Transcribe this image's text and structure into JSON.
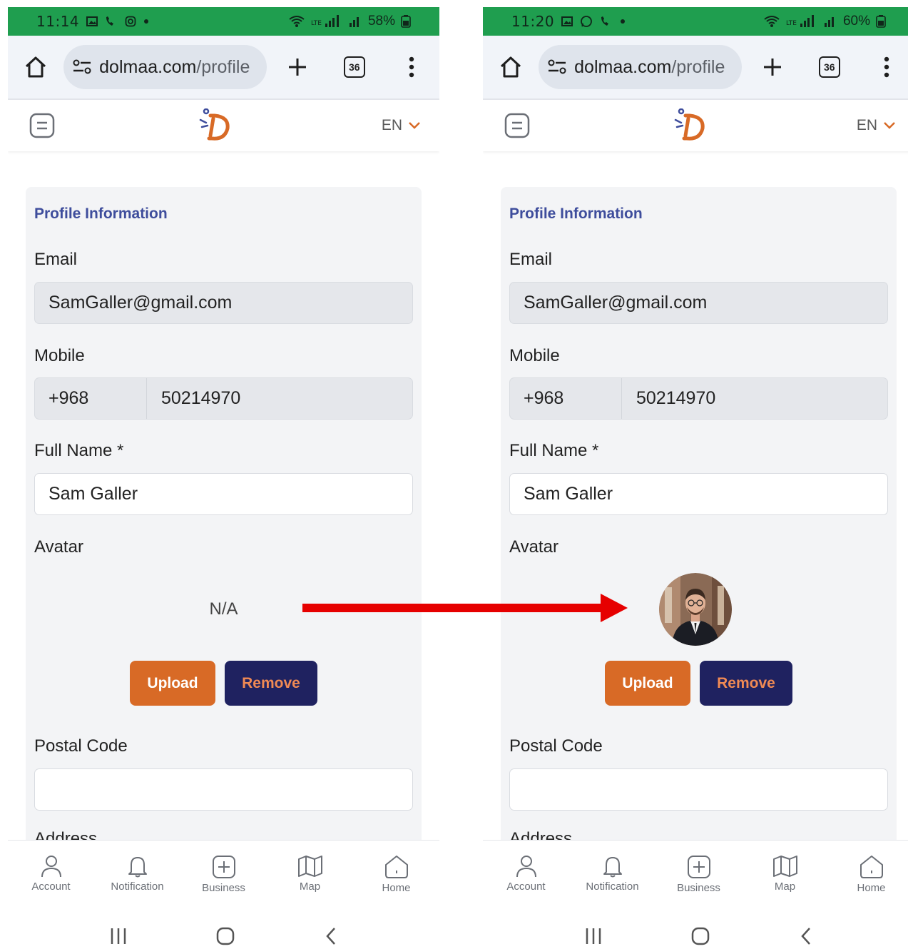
{
  "colors": {
    "status_bar": "#1f9e4f",
    "section_title": "#3e4d9c",
    "upload_button": "#d86a26",
    "remove_button": "#1f2260",
    "remove_text": "#f08a54",
    "arrow": "#e60000"
  },
  "arrow_icon": "right-arrow-icon",
  "screens": [
    {
      "status": {
        "time": "11:14",
        "battery": "58%"
      },
      "browser": {
        "host": "dolmaa.com",
        "path": "/profile",
        "tab_count": "36"
      },
      "header": {
        "language": "EN"
      },
      "profile": {
        "section_title": "Profile Information",
        "email_label": "Email",
        "email_value": "SamGaller@gmail.com",
        "mobile_label": "Mobile",
        "country_code": "+968",
        "mobile_value": "50214970",
        "name_label": "Full Name *",
        "name_value": "Sam Galler",
        "avatar_label": "Avatar",
        "avatar_placeholder": "N/A",
        "upload_label": "Upload",
        "remove_label": "Remove",
        "postal_label": "Postal Code",
        "postal_value": "",
        "address_label": "Address"
      },
      "nav": [
        {
          "label": "Account",
          "icon": "person-icon"
        },
        {
          "label": "Notification",
          "icon": "bell-icon"
        },
        {
          "label": "Business",
          "icon": "plus-square-icon"
        },
        {
          "label": "Map",
          "icon": "map-icon"
        },
        {
          "label": "Home",
          "icon": "home-icon"
        }
      ]
    },
    {
      "status": {
        "time": "11:20",
        "battery": "60%"
      },
      "browser": {
        "host": "dolmaa.com",
        "path": "/profile",
        "tab_count": "36"
      },
      "header": {
        "language": "EN"
      },
      "profile": {
        "section_title": "Profile Information",
        "email_label": "Email",
        "email_value": "SamGaller@gmail.com",
        "mobile_label": "Mobile",
        "country_code": "+968",
        "mobile_value": "50214970",
        "name_label": "Full Name *",
        "name_value": "Sam Galler",
        "avatar_label": "Avatar",
        "avatar_image": "profile-photo",
        "upload_label": "Upload",
        "remove_label": "Remove",
        "postal_label": "Postal Code",
        "postal_value": "",
        "address_label": "Address"
      },
      "nav": [
        {
          "label": "Account",
          "icon": "person-icon"
        },
        {
          "label": "Notification",
          "icon": "bell-icon"
        },
        {
          "label": "Business",
          "icon": "plus-square-icon"
        },
        {
          "label": "Map",
          "icon": "map-icon"
        },
        {
          "label": "Home",
          "icon": "home-icon"
        }
      ]
    }
  ]
}
